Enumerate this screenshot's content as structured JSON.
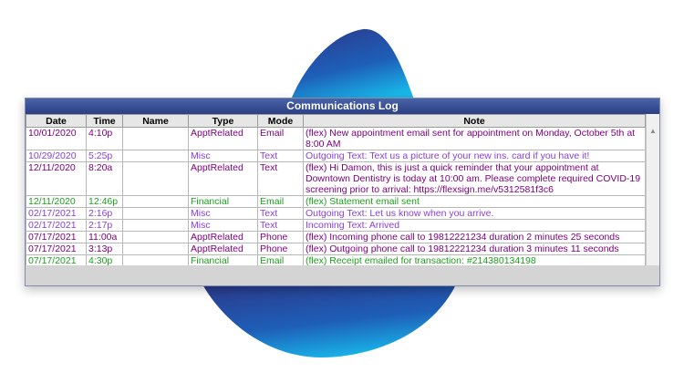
{
  "window": {
    "title": "Communications Log"
  },
  "columns": [
    "Date",
    "Time",
    "Name",
    "Type",
    "Mode",
    "Note"
  ],
  "colors": {
    "ApptRelated": "#800080",
    "Misc": "#8a3fd8",
    "Financial": "#1ca01c"
  },
  "rows": [
    {
      "date": "10/01/2020",
      "time": "4:10p",
      "name": "",
      "type": "ApptRelated",
      "mode": "Email",
      "note": "(flex) New appointment email sent for appointment on Monday, October 5th at 8:00 AM"
    },
    {
      "date": "10/29/2020",
      "time": "5:25p",
      "name": "",
      "type": "Misc",
      "mode": "Text",
      "note": "Outgoing Text: Text us a picture of your new ins. card if you have it!"
    },
    {
      "date": "12/11/2020",
      "time": "8:20a",
      "name": "",
      "type": "ApptRelated",
      "mode": "Text",
      "note": "(flex) Hi Damon, this is just a quick reminder that your appointment at Downtown Dentistry is today at 10:00 am. Please complete required COVID-19 screening prior to arrival:  https://flexsign.me/v5312581f3c6"
    },
    {
      "date": "12/11/2020",
      "time": "12:46p",
      "name": "",
      "type": "Financial",
      "mode": "Email",
      "note": "(flex) Statement email sent"
    },
    {
      "date": "02/17/2021",
      "time": "2:16p",
      "name": "",
      "type": "Misc",
      "mode": "Text",
      "note": "Outgoing Text: Let us know when you arrive."
    },
    {
      "date": "02/17/2021",
      "time": "2:17p",
      "name": "",
      "type": "Misc",
      "mode": "Text",
      "note": "Incoming Text: Arrived"
    },
    {
      "date": "07/17/2021",
      "time": "11:00a",
      "name": "",
      "type": "ApptRelated",
      "mode": "Phone",
      "note": "(flex) Incoming phone call to 19812221234 duration 2 minutes 25 seconds"
    },
    {
      "date": "07/17/2021",
      "time": "3:13p",
      "name": "",
      "type": "ApptRelated",
      "mode": "Phone",
      "note": "(flex) Outgoing phone call to 19812221234 duration 3 minutes 11 seconds"
    },
    {
      "date": "07/17/2021",
      "time": "4:30p",
      "name": "",
      "type": "Financial",
      "mode": "Email",
      "note": "(flex) Receipt emailed for transaction: #214380134198"
    }
  ],
  "scrollbar": {
    "up_icon": "arrow-up-icon"
  }
}
